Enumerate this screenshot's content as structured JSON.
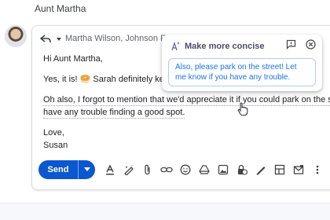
{
  "previous_message": {
    "sender": "Aunt Martha"
  },
  "compose": {
    "recipients": "Martha Wilson, Johnson Fami",
    "body": {
      "greeting": "Hi Aunt Martha,",
      "line1": "Yes, it is! 🥯 Sarah definitely kept Ti",
      "line2": "Oh also, I forgot to mention that we'd appreciate it if you could park on the street if this",
      "line3": "have any trouble finding a good spot.",
      "closing": "Love,",
      "signature": "Susan"
    }
  },
  "ai_suggestion": {
    "title": "Make more concise",
    "text": "Also, please park on the street! Let me know if you have any trouble."
  },
  "toolbar": {
    "send_label": "Send"
  },
  "icons": [
    "reply-icon",
    "dropdown-icon",
    "sparkle-icon",
    "feedback-icon",
    "close-icon",
    "pointer-cursor-icon",
    "format-text-icon",
    "ai-pen-icon",
    "attach-icon",
    "link-icon",
    "emoji-icon",
    "drive-icon",
    "photo-icon",
    "lock-clock-icon",
    "signature-icon",
    "layout-icon",
    "template-icon",
    "more-vert-icon"
  ],
  "colors": {
    "accent": "#0b57d0",
    "suggestion_text": "#1a73e8",
    "suggestion_border": "#aecbfa"
  }
}
